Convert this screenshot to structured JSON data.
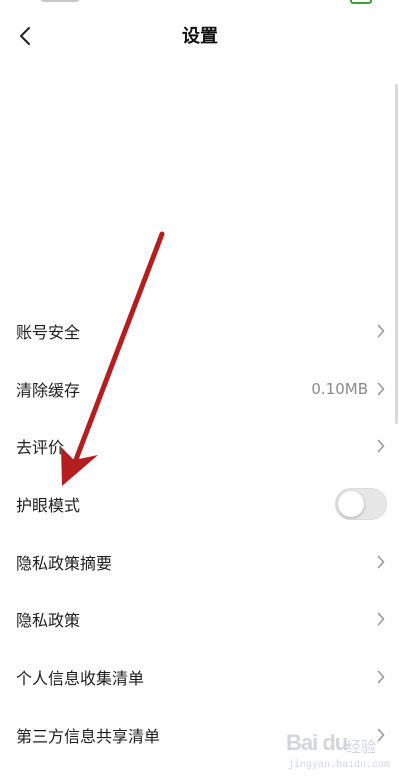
{
  "header": {
    "title": "设置",
    "back_icon": "chevron-left-icon"
  },
  "settings": {
    "items": [
      {
        "label": "账号安全",
        "type": "link"
      },
      {
        "label": "清除缓存",
        "type": "link",
        "value": "0.10MB"
      },
      {
        "label": "去评价",
        "type": "link"
      },
      {
        "label": "护眼模式",
        "type": "toggle",
        "enabled": false
      },
      {
        "label": "隐私政策摘要",
        "type": "link"
      },
      {
        "label": "隐私政策",
        "type": "link"
      },
      {
        "label": "个人信息收集清单",
        "type": "link"
      },
      {
        "label": "第三方信息共享清单",
        "type": "link"
      }
    ]
  },
  "annotation": {
    "arrow_color": "#b41e1e"
  },
  "watermark": {
    "logo": "Bai du",
    "sub": "经验",
    "url": "jingyan.baidu.com"
  },
  "colors": {
    "battery": "#3aa33a",
    "toggle_off": "#e6e6e6",
    "chevron": "#9a9a9a"
  }
}
